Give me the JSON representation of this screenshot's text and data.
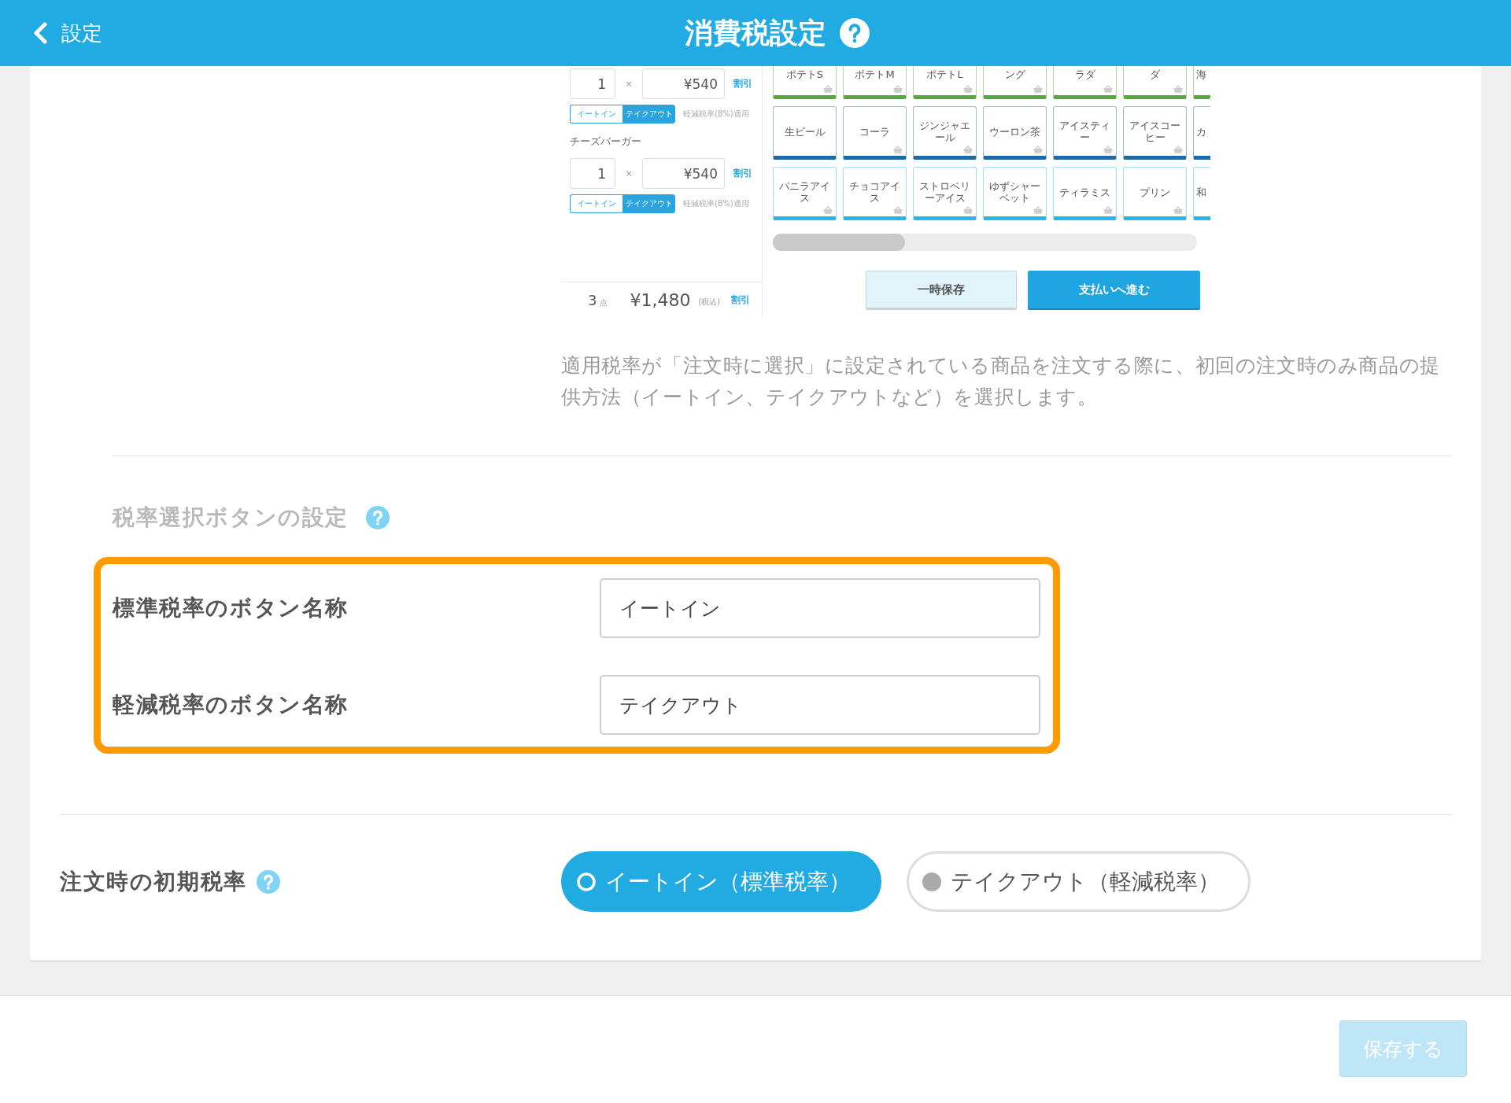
{
  "header": {
    "back_label": "設定",
    "title": "消費税設定"
  },
  "preview": {
    "order_items": [
      {
        "quantity": "1",
        "times": "×",
        "price": "¥540",
        "discount": "割引",
        "options": [
          {
            "label": "イートイン",
            "selected": false
          },
          {
            "label": "テイクアウト",
            "selected": true
          }
        ],
        "note": "軽減税率(8%)適用"
      },
      {
        "name": "チーズバーガー",
        "quantity": "1",
        "times": "×",
        "price": "¥540",
        "discount": "割引",
        "options": [
          {
            "label": "イートイン",
            "selected": false
          },
          {
            "label": "テイクアウト",
            "selected": true
          }
        ],
        "note": "軽減税率(8%)適用"
      }
    ],
    "summary": {
      "count": "3",
      "unit": "点",
      "total": "¥1,480",
      "tax_note": "(税込)",
      "discount": "割引"
    },
    "tile_rows": [
      {
        "color": "#56a83a",
        "tiles": [
          {
            "label": "ポテトS",
            "basket": true
          },
          {
            "label": "ポテトM",
            "basket": true
          },
          {
            "label": "ポテトL",
            "basket": true
          },
          {
            "label": "ング",
            "basket": true
          },
          {
            "label": "ラダ",
            "basket": true
          },
          {
            "label": "ダ",
            "basket": true
          },
          {
            "label": "海",
            "basket": false
          }
        ]
      },
      {
        "color": "#1d6aa5",
        "tiles": [
          {
            "label": "生ビール",
            "basket": false
          },
          {
            "label": "コーラ",
            "basket": true
          },
          {
            "label": "ジンジャエール",
            "basket": true
          },
          {
            "label": "ウーロン茶",
            "basket": true
          },
          {
            "label": "アイスティー",
            "basket": true
          },
          {
            "label": "アイスコーヒー",
            "basket": true
          },
          {
            "label": "カ",
            "basket": false
          }
        ]
      },
      {
        "color": "#27b5ea",
        "tiles": [
          {
            "label": "バニラアイス",
            "basket": true
          },
          {
            "label": "チョコアイス",
            "basket": true
          },
          {
            "label": "ストロベリーアイス",
            "basket": true
          },
          {
            "label": "ゆずシャーベット",
            "basket": true
          },
          {
            "label": "ティラミス",
            "basket": true
          },
          {
            "label": "プリン",
            "basket": true
          },
          {
            "label": "和",
            "basket": false
          }
        ]
      }
    ],
    "buttons": [
      {
        "label": "一時保存",
        "kind": "secondary"
      },
      {
        "label": "支払いへ進む",
        "kind": "primary"
      }
    ]
  },
  "description": "適用税率が「注文時に選択」に設定されている商品を注文する際に、初回の注文時のみ商品の提供方法（イートイン、テイクアウトなど）を選択します。",
  "button_names": {
    "title": "税率選択ボタンの設定",
    "fields": [
      {
        "label": "標準税率のボタン名称",
        "value": "イートイン"
      },
      {
        "label": "軽減税率のボタン名称",
        "value": "テイクアウト"
      }
    ]
  },
  "initial_rate": {
    "label": "注文時の初期税率",
    "options": [
      {
        "label": "イートイン（標準税率）",
        "selected": true
      },
      {
        "label": "テイクアウト（軽減税率）",
        "selected": false
      }
    ]
  },
  "footer": {
    "save": {
      "label": "保存する",
      "disabled": true
    }
  }
}
